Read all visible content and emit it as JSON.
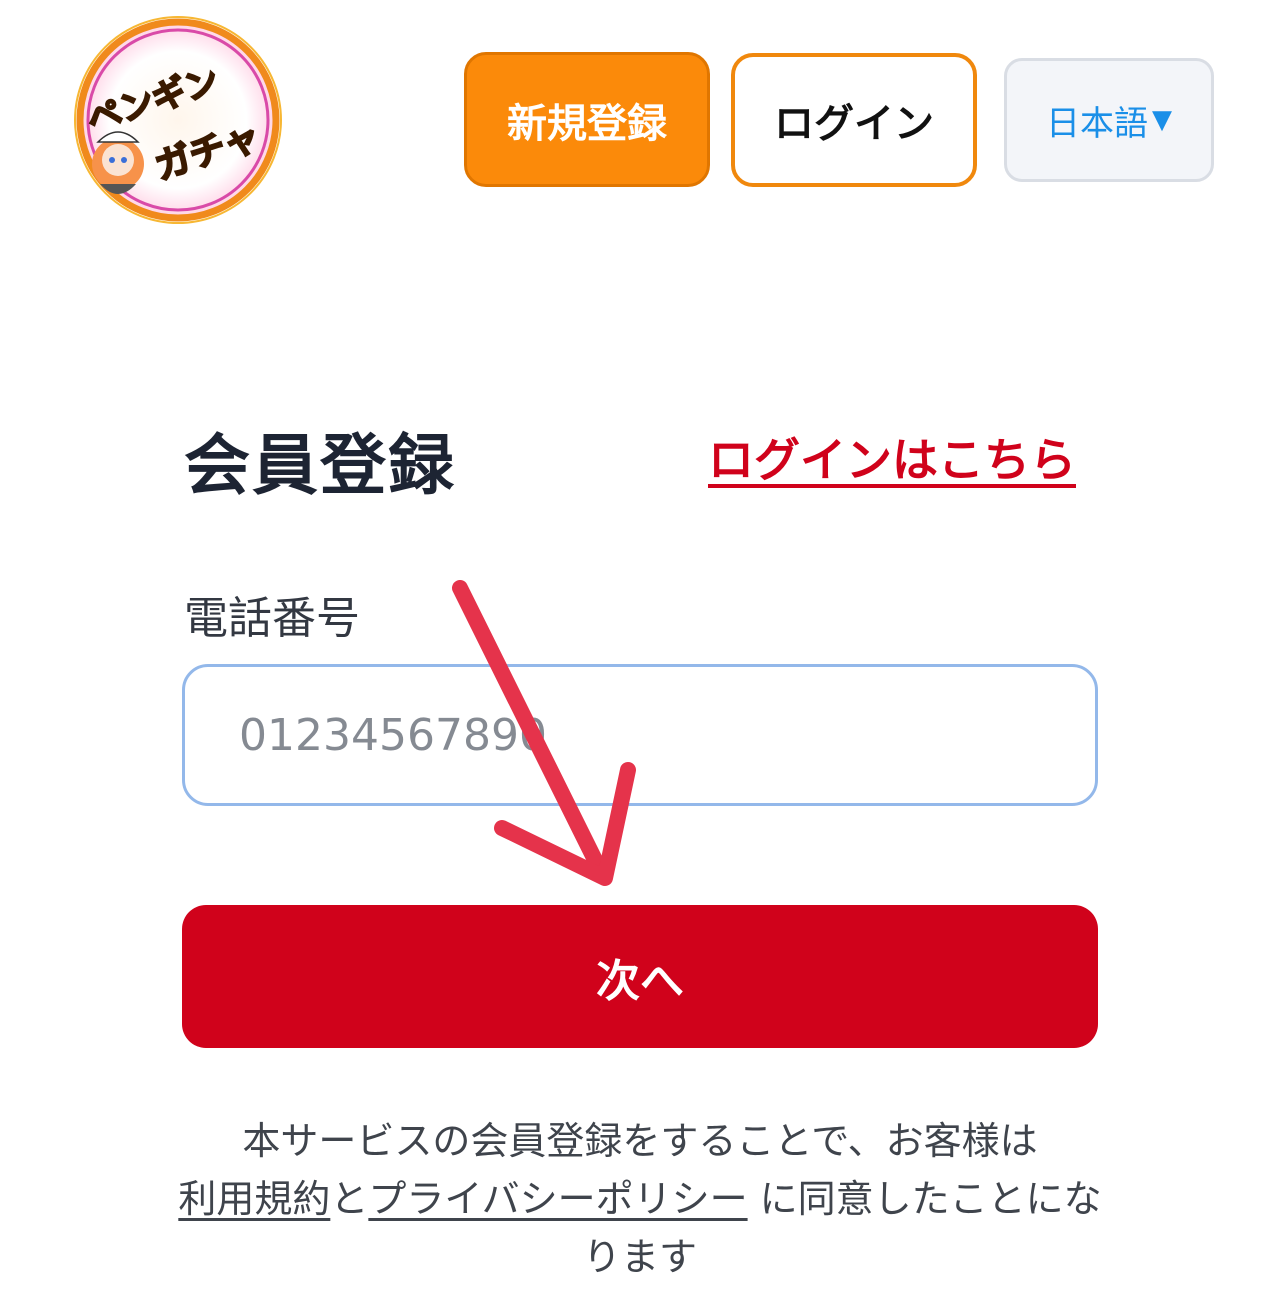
{
  "header": {
    "logo_text_line1": "ペンギン",
    "logo_text_line2": "ガチャ",
    "register_label": "新規登録",
    "login_label": "ログイン",
    "language_label": "日本語",
    "language_caret": "▼"
  },
  "form": {
    "title": "会員登録",
    "login_link": "ログインはこちら",
    "phone_label": "電話番号",
    "phone_placeholder": "01234567890",
    "next_label": "次へ"
  },
  "terms": {
    "line1": "本サービスの会員登録をすることで、お客様は",
    "terms_link": "利用規約",
    "connector": "と",
    "privacy_link": "プライバシーポリシー",
    "tail": " に同意したことになります"
  },
  "colors": {
    "primary_red": "#d0021b",
    "orange": "#fb8a0a",
    "language_blue": "#1a8fe8",
    "arrow_red": "#e5334b"
  },
  "icons": {
    "arrow": "down-arrow-annotation",
    "caret": "caret-down-icon"
  }
}
